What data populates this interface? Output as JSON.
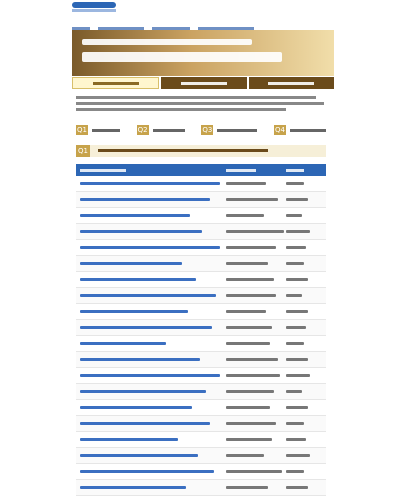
{
  "tabs": [
    {
      "active": true
    },
    {
      "active": false
    },
    {
      "active": false
    }
  ],
  "question_nav": [
    {
      "icon": "Q1"
    },
    {
      "icon": "Q2"
    },
    {
      "icon": "Q3"
    },
    {
      "icon": "Q4"
    }
  ],
  "question_header": {
    "badge": "Q1"
  },
  "table": {
    "rows": [
      {},
      {},
      {},
      {},
      {},
      {},
      {},
      {},
      {},
      {},
      {},
      {},
      {},
      {},
      {},
      {},
      {},
      {},
      {},
      {}
    ]
  }
}
